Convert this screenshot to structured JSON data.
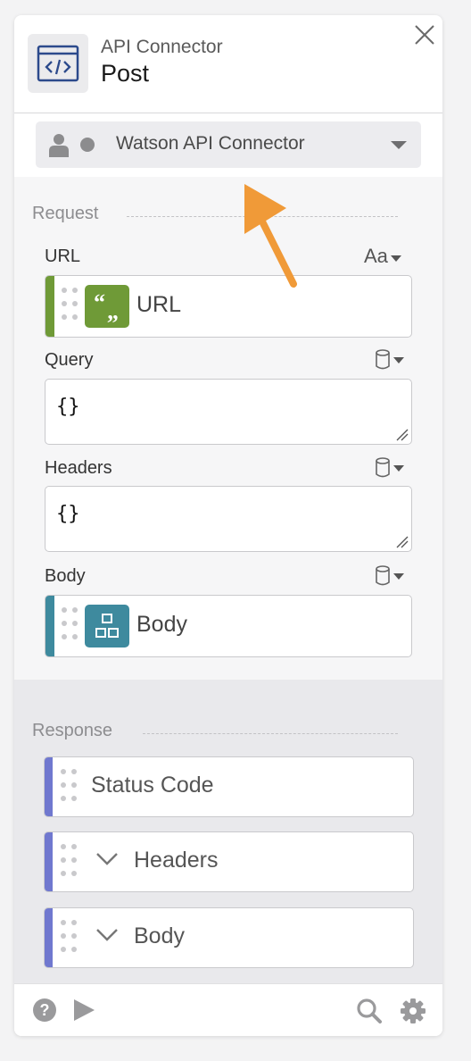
{
  "header": {
    "title": "API Connector",
    "subtitle": "Post",
    "icon": "code-window-icon"
  },
  "account": {
    "name": "Watson API Connector",
    "status_color": "#8c8c8e"
  },
  "request": {
    "section_title": "Request",
    "url": {
      "label": "URL",
      "option": "Aa",
      "token": "URL",
      "token_icon": "text-quote-icon",
      "accent": "#6f9a37"
    },
    "query": {
      "label": "Query",
      "value": "{}",
      "option_icon": "database-icon"
    },
    "headers": {
      "label": "Headers",
      "value": "{}",
      "option_icon": "database-icon"
    },
    "body": {
      "label": "Body",
      "token": "Body",
      "token_icon": "object-grid-icon",
      "accent": "#3e8a9e",
      "option_icon": "database-icon"
    }
  },
  "response": {
    "section_title": "Response",
    "accent": "#7078cf",
    "items": [
      {
        "label": "Status Code",
        "expandable": false
      },
      {
        "label": "Headers",
        "expandable": true
      },
      {
        "label": "Body",
        "expandable": true
      }
    ]
  },
  "footer": {
    "icons": [
      "help-icon",
      "play-icon",
      "search-icon",
      "gear-icon"
    ]
  },
  "annotation": {
    "color": "#f09a38",
    "icon": "arrow-icon"
  }
}
